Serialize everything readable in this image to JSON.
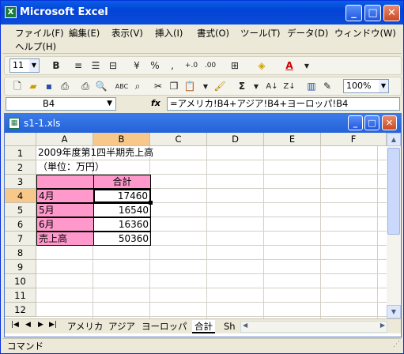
{
  "app": {
    "title": "Microsoft Excel"
  },
  "menu": [
    "ファイル(F)",
    "編集(E)",
    "表示(V)",
    "挿入(I)",
    "書式(O)",
    "ツール(T)",
    "データ(D)",
    "ウィンドウ(W)",
    "ヘルプ(H)"
  ],
  "toolbar1": {
    "font_size": "11",
    "bold": "B",
    "percent": "%",
    "comma": ",",
    "inc_dec": "+.0",
    "dec_dec": ".00"
  },
  "toolbar2": {
    "sum": "Σ",
    "zoom": "100%"
  },
  "formula_bar": {
    "name_box": "B4",
    "fx": "fx",
    "formula": "=アメリカ!B4+アジア!B4+ヨーロッパ!B4"
  },
  "workbook": {
    "title": "s1-1.xls"
  },
  "columns": [
    "A",
    "B",
    "C",
    "D",
    "E",
    "F"
  ],
  "rows": [
    "1",
    "2",
    "3",
    "4",
    "5",
    "6",
    "7",
    "8",
    "9",
    "10",
    "11",
    "12"
  ],
  "cells": {
    "a1": "2009年度第1四半期売上高",
    "a2": "（単位：万円）",
    "b3": "合計",
    "a4": "4月",
    "b4": "17460",
    "a5": "5月",
    "b5": "16540",
    "a6": "6月",
    "b6": "16360",
    "a7": "売上高",
    "b7": "50360"
  },
  "sheet_tabs": [
    "アメリカ",
    "アジア",
    "ヨーロッパ",
    "合計",
    "Sh"
  ],
  "active_sheet": "合計",
  "status": {
    "text": "コマンド"
  },
  "colors": {
    "pink": "#ff99cc",
    "selected_header": "#f7c88a",
    "title_bar": "#0a5fe8"
  }
}
